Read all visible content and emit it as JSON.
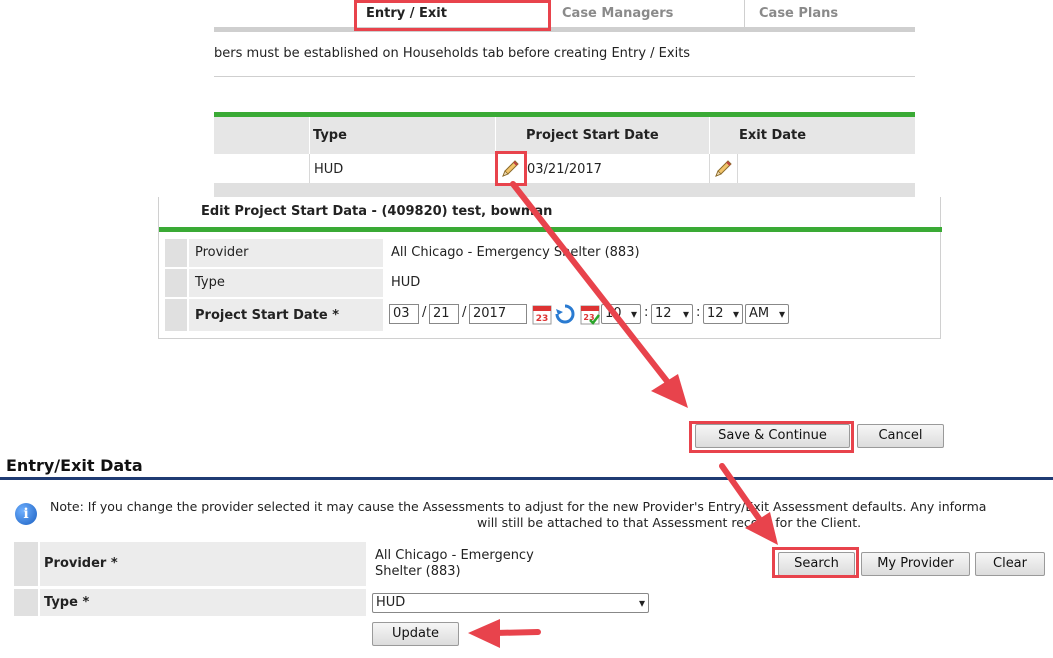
{
  "tabs": {
    "entry_exit": "Entry / Exit",
    "case_managers": "Case Managers",
    "case_plans": "Case Plans"
  },
  "notice": "bers must be established on Households tab before creating Entry / Exits",
  "grid": {
    "headers": {
      "type": "Type",
      "project_start_date": "Project Start Date",
      "exit_date": "Exit Date"
    },
    "row": {
      "type": "HUD",
      "project_start_date": "03/21/2017"
    }
  },
  "edit": {
    "title": "Edit Project Start Data - (409820) test, bowman",
    "provider_label": "Provider",
    "provider_value": "All Chicago - Emergency Shelter (883)",
    "type_label": "Type",
    "type_value": "HUD",
    "start_label": "Project Start Date",
    "required_mark": "*",
    "month": "03",
    "day": "21",
    "year": "2017",
    "hour": "10",
    "minute": "12",
    "second": "12",
    "ampm": "AM",
    "date_sep": "/",
    "time_sep": ":"
  },
  "actions": {
    "save_continue": "Save & Continue",
    "cancel": "Cancel"
  },
  "entry_exit_data": {
    "title": "Entry/Exit Data",
    "note_line1": "Note: If you change the provider selected it may cause the Assessments to adjust for the new Provider's Entry/Exit Assessment defaults. Any informa",
    "note_line2": "will still be attached to that Assessment record for the Client.",
    "provider_label": "Provider",
    "provider_value_line1": "All Chicago - Emergency",
    "provider_value_line2": "Shelter (883)",
    "type_label": "Type",
    "type_value": "HUD",
    "search": "Search",
    "my_provider": "My Provider",
    "clear": "Clear",
    "update": "Update"
  },
  "colors": {
    "green": "#3aaa35",
    "highlight_red": "#e8434c",
    "navy": "#1f3b73"
  }
}
